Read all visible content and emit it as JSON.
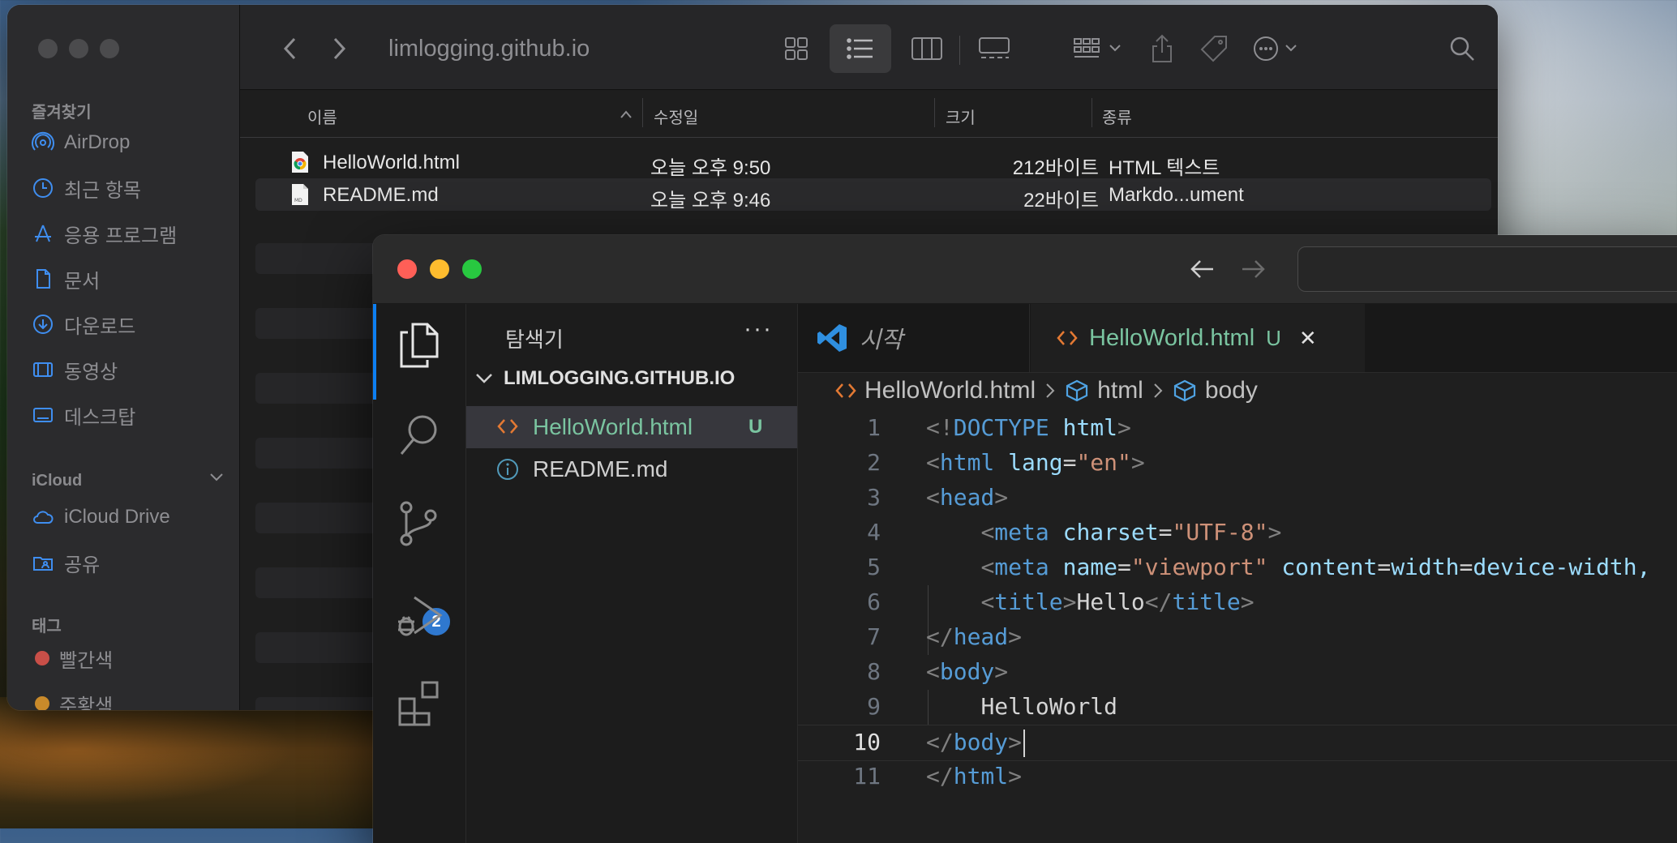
{
  "finder": {
    "title": "limlogging.github.io",
    "sidebar": {
      "favorites_heading": "즐겨찾기",
      "favorites": [
        {
          "label": "AirDrop",
          "icon": "airdrop-icon"
        },
        {
          "label": "최근 항목",
          "icon": "clock-icon"
        },
        {
          "label": "응용 프로그램",
          "icon": "applications-icon"
        },
        {
          "label": "문서",
          "icon": "document-icon"
        },
        {
          "label": "다운로드",
          "icon": "download-icon"
        },
        {
          "label": "동영상",
          "icon": "film-icon"
        },
        {
          "label": "데스크탑",
          "icon": "desktop-icon"
        }
      ],
      "icloud_heading": "iCloud",
      "icloud": [
        {
          "label": "iCloud Drive",
          "icon": "cloud-icon"
        },
        {
          "label": "공유",
          "icon": "shared-folder-icon"
        }
      ],
      "tags_heading": "태그",
      "tags": [
        {
          "label": "빨간색",
          "color": "#c94f48"
        },
        {
          "label": "주황색",
          "color": "#c98a2a"
        }
      ]
    },
    "columns": {
      "name": "이름",
      "modified": "수정일",
      "size": "크기",
      "kind": "종류"
    },
    "files": [
      {
        "name": "HelloWorld.html",
        "modified": "오늘 오후 9:50",
        "size": "212바이트",
        "kind": "HTML 텍스트",
        "icon": "chrome-html-file-icon"
      },
      {
        "name": "README.md",
        "modified": "오늘 오후 9:46",
        "size": "22바이트",
        "kind": "Markdo...ument",
        "icon": "markdown-file-icon"
      }
    ]
  },
  "vscode": {
    "explorer_title": "탐색기",
    "explorer_more": "···",
    "folder_name": "LIMLOGGING.GITHUB.IO",
    "tree": [
      {
        "name": "HelloWorld.html",
        "status": "U",
        "selected": true
      },
      {
        "name": "README.md",
        "status": "",
        "selected": false
      }
    ],
    "scm_badge": "2",
    "tabs": {
      "welcome_label": "시작",
      "active_label": "HelloWorld.html",
      "active_status": "U",
      "close_glyph": "✕"
    },
    "breadcrumb": [
      "HelloWorld.html",
      "html",
      "body"
    ],
    "current_line": 10,
    "code_lines": [
      "<!DOCTYPE html>",
      "<html lang=\"en\">",
      "<head>",
      "    <meta charset=\"UTF-8\">",
      "    <meta name=\"viewport\" content=\"width=device-width,",
      "    <title>Hello</title>",
      "</head>",
      "<body>",
      "    HelloWorld",
      "</body>",
      "</html>"
    ]
  },
  "colors": {
    "accent_blue": "#0d7ff2",
    "untracked_green": "#7ac4a0",
    "html_icon_orange": "#e37933",
    "traffic_red": "#ff5f57",
    "traffic_yellow": "#febc2e",
    "traffic_green": "#28c840"
  }
}
